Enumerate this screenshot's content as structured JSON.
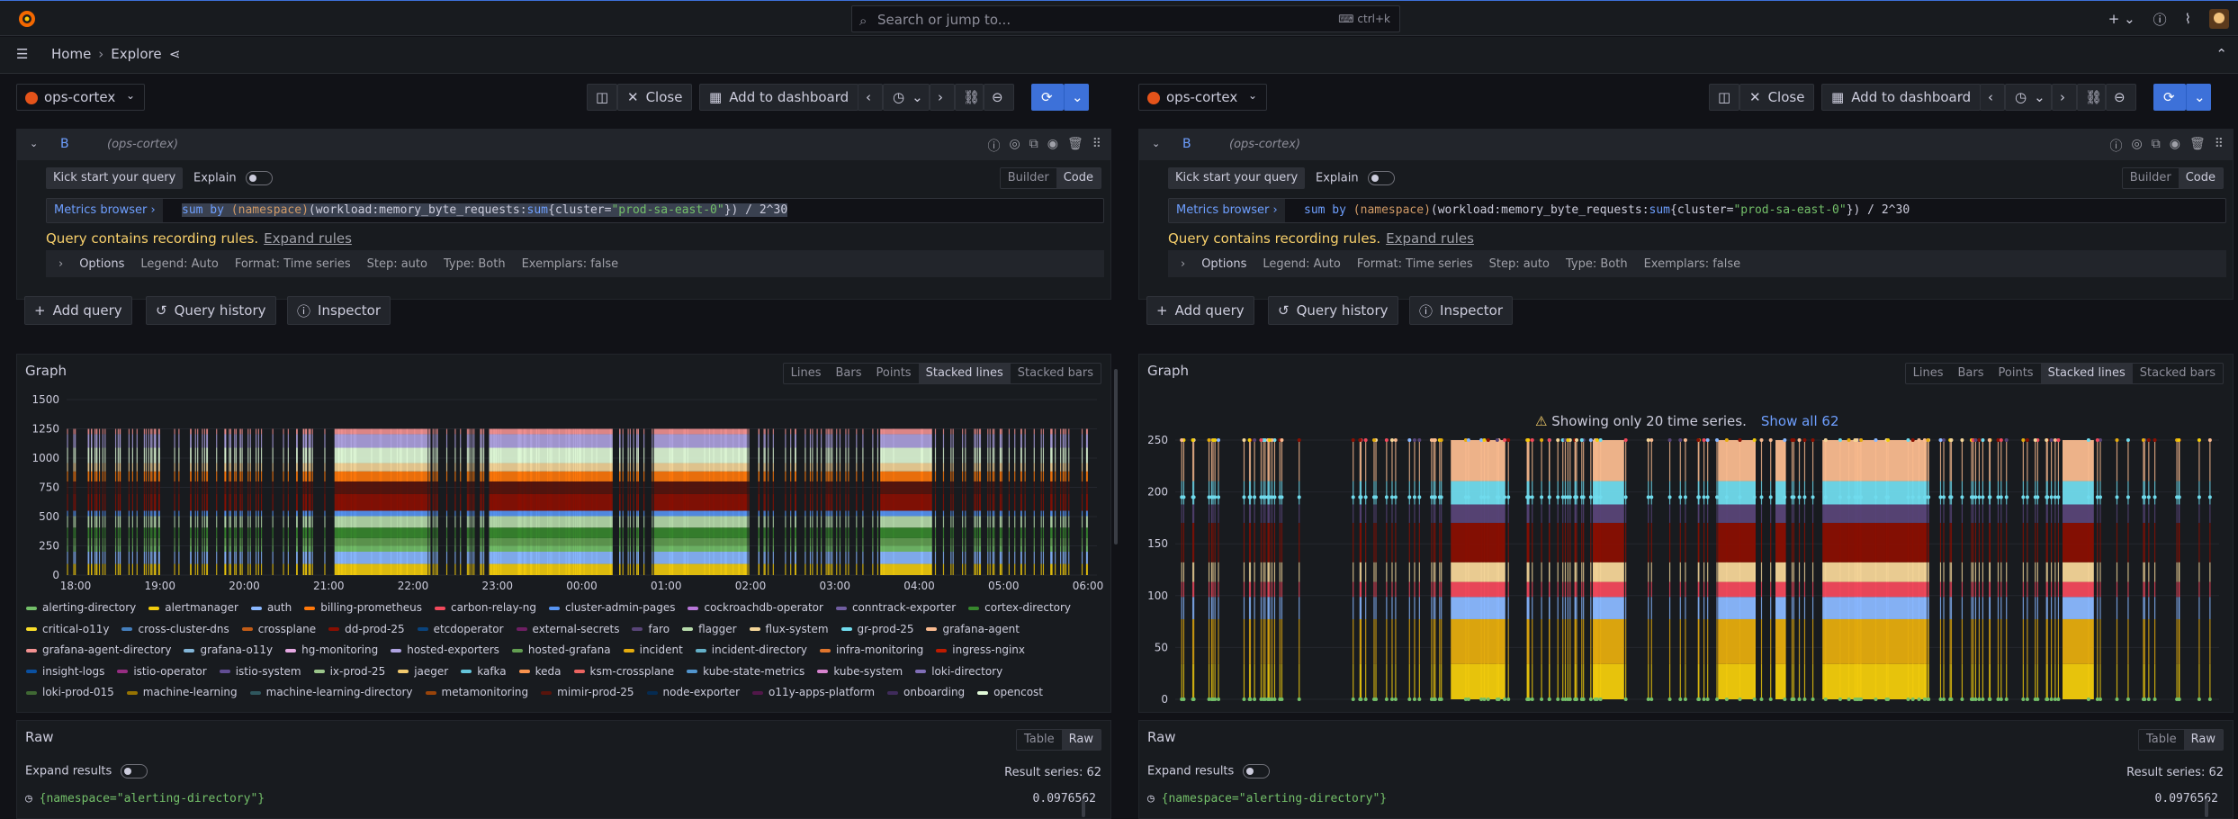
{
  "topbar": {
    "search_placeholder": "Search or jump to...",
    "shortcut": "ctrl+k",
    "icons": [
      "plus-icon",
      "help-icon",
      "rss-icon",
      "avatar"
    ]
  },
  "subbar": {
    "home": "Home",
    "explore": "Explore"
  },
  "panes": [
    {
      "datasource": "ops-cortex",
      "close_label": "Close",
      "add_dashboard_label": "Add to dashboard",
      "query": {
        "ref_id": "B",
        "ds_name": "(ops-cortex)",
        "kick_start": "Kick start your query",
        "explain": "Explain",
        "builder": "Builder",
        "code": "Code",
        "metrics_browser": "Metrics browser",
        "expr_parts": [
          "sum by ",
          "(namespace)",
          "(workload:memory_byte_requests:",
          "sum",
          "{cluster=",
          "\"prod-sa-east-0\"",
          "}) / 2^30"
        ],
        "warning": "Query contains recording rules.",
        "expand_rules": "Expand rules",
        "options": {
          "label": "Options",
          "legend": "Legend: Auto",
          "format": "Format: Time series",
          "step": "Step: auto",
          "type": "Type: Both",
          "exemplars": "Exemplars: false"
        }
      },
      "add_query": "Add query",
      "query_history": "Query history",
      "inspector": "Inspector",
      "graph": {
        "title": "Graph",
        "modes": [
          "Lines",
          "Bars",
          "Points",
          "Stacked lines",
          "Stacked bars"
        ],
        "active_mode": "Stacked lines"
      },
      "raw": {
        "title": "Raw",
        "modes": [
          "Table",
          "Raw"
        ],
        "expand_results": "Expand results",
        "result_series": "Result series: 62",
        "first_row": "{namespace=\"alerting-directory\"}",
        "first_value": "0.0976562"
      }
    },
    {
      "datasource": "ops-cortex",
      "close_label": "Close",
      "add_dashboard_label": "Add to dashboard",
      "query": {
        "ref_id": "B",
        "ds_name": "(ops-cortex)",
        "kick_start": "Kick start your query",
        "explain": "Explain",
        "builder": "Builder",
        "code": "Code",
        "metrics_browser": "Metrics browser",
        "expr_parts": [
          "sum by ",
          "(namespace)",
          "(workload:memory_byte_requests:",
          "sum",
          "{cluster=",
          "\"prod-sa-east-0\"",
          "}) / 2^30"
        ],
        "warning": "Query contains recording rules.",
        "expand_rules": "Expand rules",
        "options": {
          "label": "Options",
          "legend": "Legend: Auto",
          "format": "Format: Time series",
          "step": "Step: auto",
          "type": "Type: Both",
          "exemplars": "Exemplars: false"
        }
      },
      "add_query": "Add query",
      "query_history": "Query history",
      "inspector": "Inspector",
      "graph": {
        "title": "Graph",
        "modes": [
          "Lines",
          "Bars",
          "Points",
          "Stacked lines",
          "Stacked bars"
        ],
        "active_mode": "Stacked lines",
        "notice": "Showing only 20 time series.",
        "show_all": "Show all 62"
      },
      "raw": {
        "title": "Raw",
        "modes": [
          "Table",
          "Raw"
        ],
        "expand_results": "Expand results",
        "result_series": "Result series: 62",
        "first_row": "{namespace=\"alerting-directory\"}",
        "first_value": "0.0976562"
      }
    }
  ],
  "chart_data": [
    {
      "type": "area",
      "title": "Graph",
      "x_ticks": [
        "18:00",
        "19:00",
        "20:00",
        "21:00",
        "22:00",
        "23:00",
        "00:00",
        "01:00",
        "02:00",
        "03:00",
        "04:00",
        "05:00",
        "06:00"
      ],
      "y_ticks": [
        0,
        250,
        500,
        750,
        1000,
        1250,
        1500
      ],
      "ylim": [
        0,
        1500
      ],
      "stack_total_approx": 1250,
      "legend_position": "bottom",
      "legend": [
        {
          "name": "alerting-directory",
          "color": "#73bf69"
        },
        {
          "name": "alertmanager",
          "color": "#f2cc0c"
        },
        {
          "name": "auth",
          "color": "#8ab8ff"
        },
        {
          "name": "billing-prometheus",
          "color": "#ff780a"
        },
        {
          "name": "carbon-relay-ng",
          "color": "#f2495c"
        },
        {
          "name": "cluster-admin-pages",
          "color": "#5794f2"
        },
        {
          "name": "cockroachdb-operator",
          "color": "#b877d9"
        },
        {
          "name": "conntrack-exporter",
          "color": "#705da0"
        },
        {
          "name": "cortex-directory",
          "color": "#37872d"
        },
        {
          "name": "critical-o11y",
          "color": "#fade2a"
        },
        {
          "name": "cross-cluster-dns",
          "color": "#447ebc"
        },
        {
          "name": "crossplane",
          "color": "#c15c17"
        },
        {
          "name": "dd-prod-25",
          "color": "#890f02"
        },
        {
          "name": "etcdoperator",
          "color": "#0a437c"
        },
        {
          "name": "external-secrets",
          "color": "#6d1f62"
        },
        {
          "name": "faro",
          "color": "#584477"
        },
        {
          "name": "flagger",
          "color": "#b7dbab"
        },
        {
          "name": "flux-system",
          "color": "#f4d598"
        },
        {
          "name": "gr-prod-25",
          "color": "#70dbed"
        },
        {
          "name": "grafana-agent",
          "color": "#f9ba8f"
        },
        {
          "name": "grafana-agent-directory",
          "color": "#f29191"
        },
        {
          "name": "grafana-o11y",
          "color": "#82b5d8"
        },
        {
          "name": "hg-monitoring",
          "color": "#e5a8e2"
        },
        {
          "name": "hosted-exporters",
          "color": "#aea2e0"
        },
        {
          "name": "hosted-grafana",
          "color": "#629e51"
        },
        {
          "name": "incident",
          "color": "#e5ac0e"
        },
        {
          "name": "incident-directory",
          "color": "#64b0c8"
        },
        {
          "name": "infra-monitoring",
          "color": "#e0752d"
        },
        {
          "name": "ingress-nginx",
          "color": "#bf1b00"
        },
        {
          "name": "insight-logs",
          "color": "#0a50a1"
        },
        {
          "name": "istio-operator",
          "color": "#962d82"
        },
        {
          "name": "istio-system",
          "color": "#614d93"
        },
        {
          "name": "ix-prod-25",
          "color": "#9ac48a"
        },
        {
          "name": "jaeger",
          "color": "#f2c96d"
        },
        {
          "name": "kafka",
          "color": "#65c5db"
        },
        {
          "name": "keda",
          "color": "#f9934e"
        },
        {
          "name": "ksm-crossplane",
          "color": "#ea6460"
        },
        {
          "name": "kube-state-metrics",
          "color": "#5195ce"
        },
        {
          "name": "kube-system",
          "color": "#d683ce"
        },
        {
          "name": "loki-directory",
          "color": "#806eb7"
        },
        {
          "name": "loki-prod-015",
          "color": "#3f6833"
        },
        {
          "name": "machine-learning",
          "color": "#967302"
        },
        {
          "name": "machine-learning-directory",
          "color": "#2f575e"
        },
        {
          "name": "metamonitoring",
          "color": "#99440a"
        },
        {
          "name": "mimir-prod-25",
          "color": "#58140c"
        },
        {
          "name": "node-exporter",
          "color": "#052b51"
        },
        {
          "name": "o11y-apps-platform",
          "color": "#511749"
        },
        {
          "name": "onboarding",
          "color": "#3f2b5b"
        },
        {
          "name": "opencost",
          "color": "#e0f9d7"
        }
      ]
    },
    {
      "type": "area",
      "title": "Graph",
      "y_ticks": [
        0,
        50,
        100,
        150,
        200,
        250
      ],
      "ylim": [
        0,
        250
      ],
      "stack_total_approx": 250,
      "series_shown": 20,
      "series_total": 62
    }
  ]
}
